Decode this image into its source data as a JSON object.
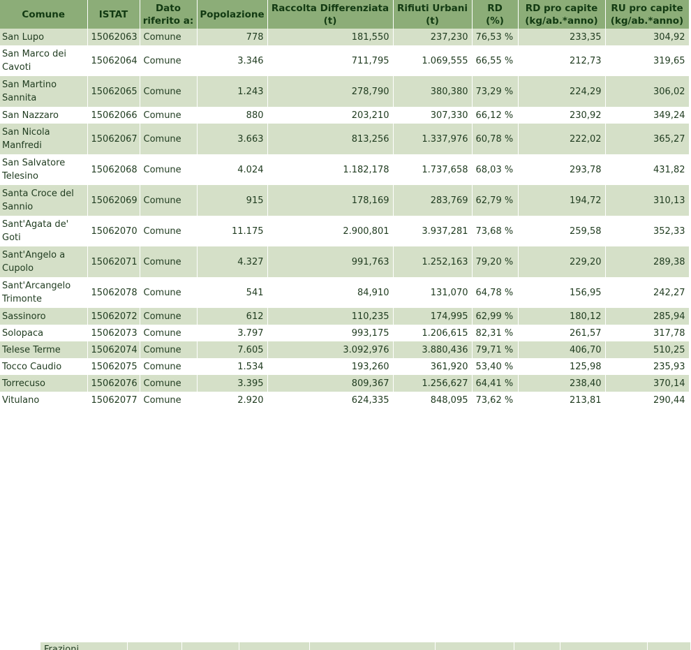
{
  "table": {
    "headers": [
      {
        "line1": "Comune",
        "line2": ""
      },
      {
        "line1": "ISTAT",
        "line2": ""
      },
      {
        "line1": "Dato",
        "line2": "riferito a:"
      },
      {
        "line1": "Popolazione",
        "line2": ""
      },
      {
        "line1": "Raccolta Differenziata",
        "line2": "(t)"
      },
      {
        "line1": "Rifiuti Urbani",
        "line2": "(t)"
      },
      {
        "line1": "RD",
        "line2": "(%)"
      },
      {
        "line1": "RD pro capite",
        "line2": "(kg/ab.*anno)"
      },
      {
        "line1": "RU pro capite",
        "line2": "(kg/ab.*anno)"
      }
    ],
    "rows": [
      {
        "comune": [
          "San Lupo",
          ""
        ],
        "istat": "15062063",
        "dato": "Comune",
        "pop": "778",
        "rd_t": "181,550",
        "ru_t": "237,230",
        "rd_pct": "76,53 %",
        "rd_pc": "233,35",
        "ru_pc": "304,92"
      },
      {
        "comune": [
          "San Marco dei",
          "Cavoti"
        ],
        "istat": "15062064",
        "dato": "Comune",
        "pop": "3.346",
        "rd_t": "711,795",
        "ru_t": "1.069,555",
        "rd_pct": "66,55 %",
        "rd_pc": "212,73",
        "ru_pc": "319,65"
      },
      {
        "comune": [
          "San Martino",
          "Sannita"
        ],
        "istat": "15062065",
        "dato": "Comune",
        "pop": "1.243",
        "rd_t": "278,790",
        "ru_t": "380,380",
        "rd_pct": "73,29 %",
        "rd_pc": "224,29",
        "ru_pc": "306,02"
      },
      {
        "comune": [
          "San Nazzaro",
          ""
        ],
        "istat": "15062066",
        "dato": "Comune",
        "pop": "880",
        "rd_t": "203,210",
        "ru_t": "307,330",
        "rd_pct": "66,12 %",
        "rd_pc": "230,92",
        "ru_pc": "349,24"
      },
      {
        "comune": [
          "San Nicola",
          "Manfredi"
        ],
        "istat": "15062067",
        "dato": "Comune",
        "pop": "3.663",
        "rd_t": "813,256",
        "ru_t": "1.337,976",
        "rd_pct": "60,78 %",
        "rd_pc": "222,02",
        "ru_pc": "365,27"
      },
      {
        "comune": [
          "San Salvatore",
          "Telesino"
        ],
        "istat": "15062068",
        "dato": "Comune",
        "pop": "4.024",
        "rd_t": "1.182,178",
        "ru_t": "1.737,658",
        "rd_pct": "68,03 %",
        "rd_pc": "293,78",
        "ru_pc": "431,82"
      },
      {
        "comune": [
          "Santa Croce del",
          "Sannio"
        ],
        "istat": "15062069",
        "dato": "Comune",
        "pop": "915",
        "rd_t": "178,169",
        "ru_t": "283,769",
        "rd_pct": "62,79 %",
        "rd_pc": "194,72",
        "ru_pc": "310,13"
      },
      {
        "comune": [
          "Sant'Agata de'",
          "Goti"
        ],
        "istat": "15062070",
        "dato": "Comune",
        "pop": "11.175",
        "rd_t": "2.900,801",
        "ru_t": "3.937,281",
        "rd_pct": "73,68 %",
        "rd_pc": "259,58",
        "ru_pc": "352,33"
      },
      {
        "comune": [
          "Sant'Angelo a",
          "Cupolo"
        ],
        "istat": "15062071",
        "dato": "Comune",
        "pop": "4.327",
        "rd_t": "991,763",
        "ru_t": "1.252,163",
        "rd_pct": "79,20 %",
        "rd_pc": "229,20",
        "ru_pc": "289,38"
      },
      {
        "comune": [
          "Sant'Arcangelo",
          "Trimonte"
        ],
        "istat": "15062078",
        "dato": "Comune",
        "pop": "541",
        "rd_t": "84,910",
        "ru_t": "131,070",
        "rd_pct": "64,78 %",
        "rd_pc": "156,95",
        "ru_pc": "242,27"
      },
      {
        "comune": [
          "Sassinoro",
          ""
        ],
        "istat": "15062072",
        "dato": "Comune",
        "pop": "612",
        "rd_t": "110,235",
        "ru_t": "174,995",
        "rd_pct": "62,99 %",
        "rd_pc": "180,12",
        "ru_pc": "285,94"
      },
      {
        "comune": [
          "Solopaca",
          ""
        ],
        "istat": "15062073",
        "dato": "Comune",
        "pop": "3.797",
        "rd_t": "993,175",
        "ru_t": "1.206,615",
        "rd_pct": "82,31 %",
        "rd_pc": "261,57",
        "ru_pc": "317,78"
      },
      {
        "comune": [
          "Telese Terme",
          ""
        ],
        "istat": "15062074",
        "dato": "Comune",
        "pop": "7.605",
        "rd_t": "3.092,976",
        "ru_t": "3.880,436",
        "rd_pct": "79,71 %",
        "rd_pc": "406,70",
        "ru_pc": "510,25"
      },
      {
        "comune": [
          "Tocco Caudio",
          ""
        ],
        "istat": "15062075",
        "dato": "Comune",
        "pop": "1.534",
        "rd_t": "193,260",
        "ru_t": "361,920",
        "rd_pct": "53,40 %",
        "rd_pc": "125,98",
        "ru_pc": "235,93"
      },
      {
        "comune": [
          "Torrecuso",
          ""
        ],
        "istat": "15062076",
        "dato": "Comune",
        "pop": "3.395",
        "rd_t": "809,367",
        "ru_t": "1.256,627",
        "rd_pct": "64,41 %",
        "rd_pc": "238,40",
        "ru_pc": "370,14"
      },
      {
        "comune": [
          "Vitulano",
          ""
        ],
        "istat": "15062077",
        "dato": "Comune",
        "pop": "2.920",
        "rd_t": "624,335",
        "ru_t": "848,095",
        "rd_pct": "73,62 %",
        "rd_pc": "213,81",
        "ru_pc": "290,44"
      }
    ]
  },
  "bottom_table": {
    "first_cell": "Frazioni..."
  }
}
